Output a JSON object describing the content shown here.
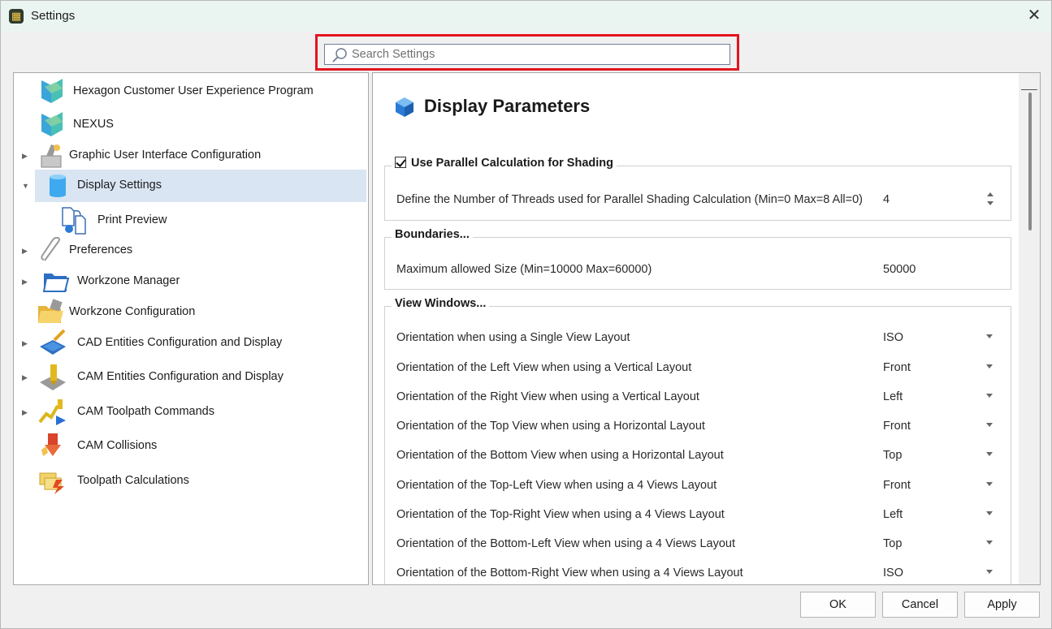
{
  "window": {
    "title": "Settings",
    "close_glyph": "✕"
  },
  "search": {
    "placeholder": "Search Settings",
    "value": ""
  },
  "tree": {
    "items": [
      {
        "label": "Hexagon Customer User Experience Program",
        "icon": "hexagon-logo-icon",
        "expandable": false
      },
      {
        "label": "NEXUS",
        "icon": "hexagon-logo-icon",
        "expandable": false
      },
      {
        "label": "Graphic User Interface Configuration",
        "icon": "gui-config-icon",
        "expandable": true,
        "expanded": false
      },
      {
        "label": "Display Settings",
        "icon": "database-cylinder-icon",
        "expandable": true,
        "expanded": true,
        "selected": true
      },
      {
        "label": "Print Preview",
        "icon": "print-preview-icon",
        "expandable": false
      },
      {
        "label": "Preferences",
        "icon": "paperclip-icon",
        "expandable": true,
        "expanded": false
      },
      {
        "label": "Workzone Manager",
        "icon": "folder-icon",
        "expandable": true,
        "expanded": false
      },
      {
        "label": "Workzone Configuration",
        "icon": "folder-config-icon",
        "expandable": false
      },
      {
        "label": "CAD Entities Configuration and Display",
        "icon": "cad-entities-icon",
        "expandable": true,
        "expanded": false
      },
      {
        "label": "CAM Entities Configuration and Display",
        "icon": "cam-entities-icon",
        "expandable": true,
        "expanded": false
      },
      {
        "label": "CAM Toolpath Commands",
        "icon": "toolpath-commands-icon",
        "expandable": true,
        "expanded": false
      },
      {
        "label": "CAM Collisions",
        "icon": "collision-icon",
        "expandable": false
      },
      {
        "label": "Toolpath Calculations",
        "icon": "toolpath-calc-icon",
        "expandable": false
      }
    ]
  },
  "content": {
    "title": "Display Parameters",
    "title_icon": "blue-cube-icon",
    "parallel": {
      "title": "Use Parallel Calculation for Shading",
      "checked": true,
      "rows": [
        {
          "label": "Define the Number of Threads used for Parallel Shading Calculation (Min=0 Max=8 All=0)",
          "value": "4",
          "control": "spinner"
        }
      ]
    },
    "boundaries": {
      "title": "Boundaries...",
      "rows": [
        {
          "label": "Maximum allowed Size (Min=10000 Max=60000)",
          "value": "50000",
          "control": "none"
        }
      ]
    },
    "view_windows": {
      "title": "View Windows...",
      "rows": [
        {
          "label": "Orientation when using a Single View Layout",
          "value": "ISO"
        },
        {
          "label": "Orientation of the Left View when using a Vertical Layout",
          "value": "Front"
        },
        {
          "label": "Orientation of the Right View when using a Vertical Layout",
          "value": "Left"
        },
        {
          "label": "Orientation of the Top View when using a Horizontal Layout",
          "value": "Front"
        },
        {
          "label": "Orientation of the Bottom View when using a Horizontal Layout",
          "value": "Top"
        },
        {
          "label": "Orientation of the Top-Left View when using a 4 Views Layout",
          "value": "Front"
        },
        {
          "label": "Orientation of the Top-Right View when using a 4 Views Layout",
          "value": "Left"
        },
        {
          "label": "Orientation of the Bottom-Left View when using a 4 Views Layout",
          "value": "Top"
        },
        {
          "label": "Orientation of the Bottom-Right View when using a 4 Views Layout",
          "value": "ISO"
        }
      ]
    }
  },
  "buttons": {
    "ok": "OK",
    "cancel": "Cancel",
    "apply": "Apply"
  },
  "colors": {
    "highlight_border": "#e3141f",
    "selection": "#d9e5f3",
    "titlebar": "#eaf4f1",
    "accent_blue": "#2b7bd6"
  }
}
